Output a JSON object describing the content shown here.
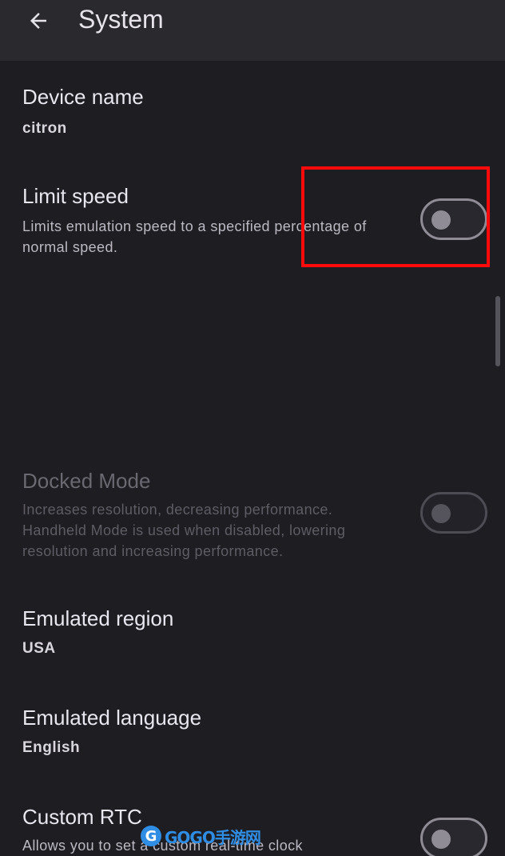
{
  "appbar": {
    "title": "System",
    "back_icon": "arrow-back-icon"
  },
  "settings": {
    "device_name": {
      "title": "Device name",
      "value": "citron"
    },
    "limit_speed": {
      "title": "Limit speed",
      "description": "Limits emulation speed to a specified percentage of normal speed.",
      "enabled": false
    },
    "docked_mode": {
      "title": "Docked Mode",
      "description": "Increases resolution, decreasing performance. Handheld Mode is used when disabled, lowering resolution and increasing performance.",
      "enabled": false,
      "disabled_item": true
    },
    "emulated_region": {
      "title": "Emulated region",
      "value": "USA"
    },
    "emulated_language": {
      "title": "Emulated language",
      "value": "English"
    },
    "custom_rtc": {
      "title": "Custom RTC",
      "description": "Allows you to set a custom real-time clock",
      "enabled": false
    }
  },
  "annotation": {
    "highlight_color": "#ff0a0a",
    "target": "limit_speed toggle"
  },
  "watermark": {
    "logo_glyph": "G",
    "text": "GOGO手游网",
    "color": "#2f8de4"
  },
  "colors": {
    "background": "#1e1d22",
    "appbar": "#2a2a2e",
    "switch_outline": "#8f8c96"
  }
}
